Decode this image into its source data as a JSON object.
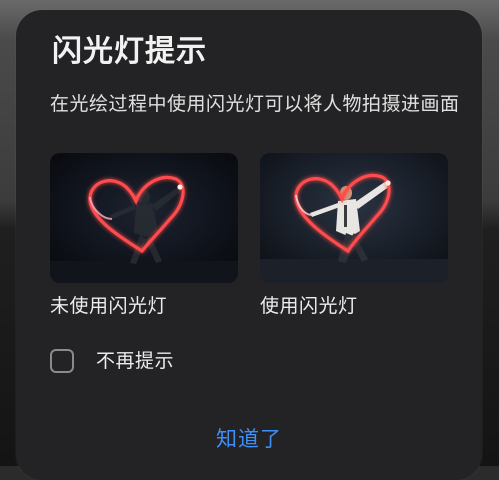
{
  "dialog": {
    "title": "闪光灯提示",
    "description": "在光绘过程中使用闪光灯可以将人物拍摄进画面",
    "examples": [
      {
        "caption": "未使用闪光灯",
        "image": "light-painting-heart-without-flash"
      },
      {
        "caption": "使用闪光灯",
        "image": "light-painting-heart-with-flash"
      }
    ],
    "dont_show_again": {
      "label": "不再提示",
      "checked": false
    },
    "confirm_label": "知道了"
  },
  "colors": {
    "dialog_background": "#232325",
    "accent": "#3f8ff7",
    "heart_light": "#ff4b4b"
  }
}
